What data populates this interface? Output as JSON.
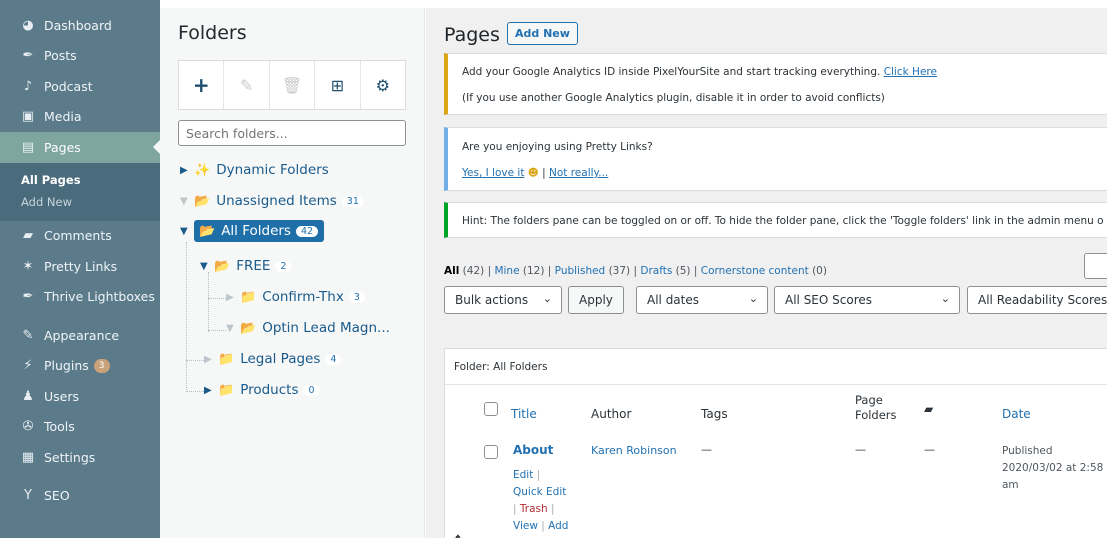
{
  "sidebar": {
    "items": [
      {
        "label": "Dashboard",
        "icon": "dashboard-icon",
        "glyph": "◕"
      },
      {
        "label": "Posts",
        "icon": "pin-icon",
        "glyph": "✒"
      },
      {
        "label": "Podcast",
        "icon": "microphone-icon",
        "glyph": "♪"
      },
      {
        "label": "Media",
        "icon": "media-icon",
        "glyph": "▣"
      },
      {
        "label": "Pages",
        "icon": "pages-icon",
        "glyph": "▤"
      }
    ],
    "submenu": [
      "All Pages",
      "Add New"
    ],
    "items2": [
      {
        "label": "Comments",
        "icon": "comments-icon",
        "glyph": "▰"
      },
      {
        "label": "Pretty Links",
        "icon": "star-link-icon",
        "glyph": "✶"
      },
      {
        "label": "Thrive Lightboxes",
        "icon": "pin-icon",
        "glyph": "✒"
      }
    ],
    "items3": [
      {
        "label": "Appearance",
        "icon": "brush-icon",
        "glyph": "✎"
      },
      {
        "label": "Plugins",
        "icon": "plugin-icon",
        "glyph": "⚡",
        "badge": "3"
      },
      {
        "label": "Users",
        "icon": "user-icon",
        "glyph": "♟"
      },
      {
        "label": "Tools",
        "icon": "wrench-icon",
        "glyph": "✇"
      },
      {
        "label": "Settings",
        "icon": "settings-icon",
        "glyph": "▦"
      }
    ],
    "items4": [
      {
        "label": "SEO",
        "icon": "yoast-icon",
        "glyph": "Y"
      }
    ]
  },
  "folders": {
    "title": "Folders",
    "search_placeholder": "Search folders...",
    "tree": {
      "dynamic": "Dynamic Folders",
      "unassigned": "Unassigned Items",
      "unassigned_count": "31",
      "all": "All Folders",
      "all_count": "42",
      "free": "FREE",
      "free_count": "2",
      "confirm": "Confirm-Thx",
      "confirm_count": "3",
      "optin": "Optin Lead Magn...",
      "legal": "Legal Pages",
      "legal_count": "4",
      "products": "Products",
      "products_count": "0"
    }
  },
  "main": {
    "title": "Pages",
    "add_new": "Add New",
    "notice1_text": "Add your Google Analytics ID inside PixelYourSite and start tracking everything.",
    "notice1_link": "Click Here",
    "notice1_line2": "(If you use another Google Analytics plugin, disable it in order to avoid conflicts)",
    "notice2_text": "Are you enjoying using Pretty Links?",
    "notice2_yes": "Yes, I love it",
    "notice2_sep": "| ",
    "notice2_no": "Not really...",
    "notice3_text": "Hint: The folders pane can be toggled on or off. To hide the folder pane, click the 'Toggle folders' link in the admin menu o",
    "filters": {
      "all": "All",
      "all_count": "(42)",
      "mine": "Mine",
      "mine_count": "(12)",
      "published": "Published",
      "published_count": "(37)",
      "drafts": "Drafts",
      "drafts_count": "(5)",
      "cornerstone": "Cornerstone content",
      "cornerstone_count": "(0)"
    },
    "bulk_actions": "Bulk actions",
    "apply": "Apply",
    "dates": "All dates",
    "seo": "All SEO Scores",
    "readability": "All Readability Scores",
    "folder_label": "Folder: All Folders",
    "columns": {
      "title": "Title",
      "author": "Author",
      "tags": "Tags",
      "page_folders_1": "Page",
      "page_folders_2": "Folders",
      "date": "Date"
    },
    "row": {
      "title": "About",
      "author": "Karen Robinson",
      "tags": "—",
      "page_folders": "—",
      "comments": "—",
      "date_status": "Published",
      "date_value": "2020/03/02 at 2:58",
      "date_ampm": "am",
      "actions": {
        "edit": "Edit",
        "quick_edit": "Quick Edit",
        "trash": "Trash",
        "view": "View",
        "add": "Add"
      }
    }
  }
}
